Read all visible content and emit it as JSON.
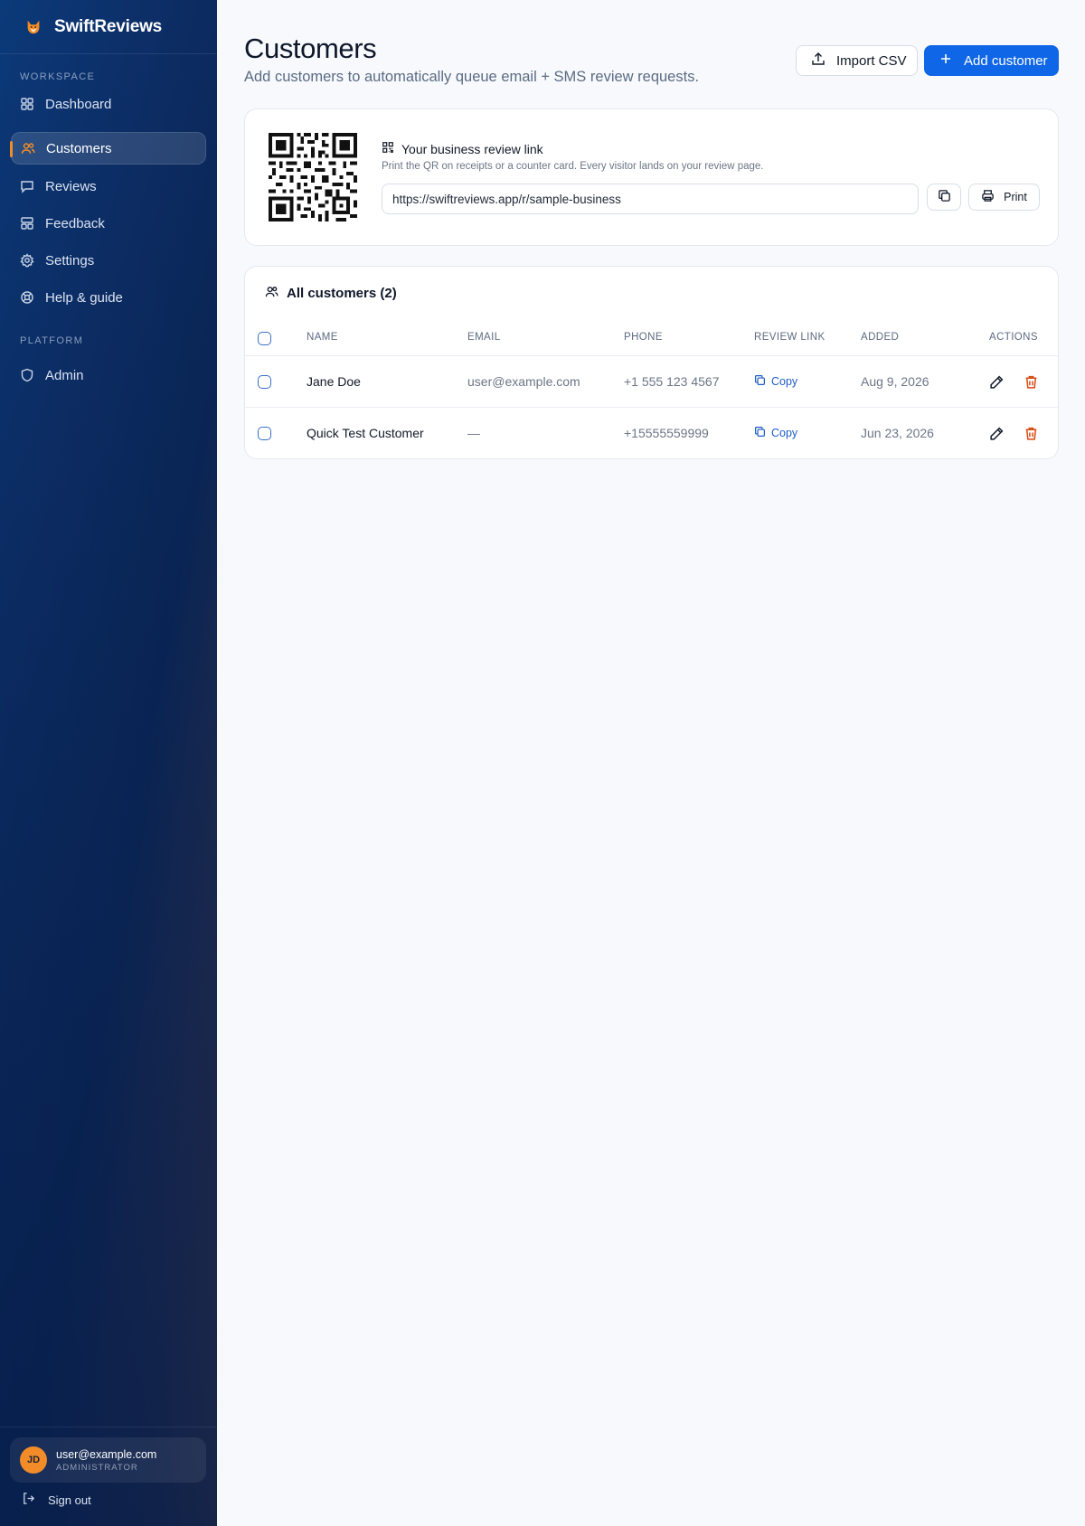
{
  "app": {
    "name": "SwiftReviews"
  },
  "sidebar": {
    "workspace_label": "WORKSPACE",
    "platform_label": "PLATFORM",
    "items": [
      {
        "label": "Dashboard",
        "icon": "grid-icon"
      },
      {
        "label": "Customers",
        "icon": "users-icon",
        "active": true
      },
      {
        "label": "Reviews",
        "icon": "message-icon"
      },
      {
        "label": "Feedback",
        "icon": "layout-icon"
      },
      {
        "label": "Settings",
        "icon": "gear-icon"
      },
      {
        "label": "Help & guide",
        "icon": "lifebuoy-icon"
      }
    ],
    "platform_items": [
      {
        "label": "Admin",
        "icon": "shield-icon"
      }
    ],
    "user": {
      "initials": "JD",
      "email": "user@example.com",
      "role": "ADMINISTRATOR"
    },
    "sign_out": "Sign out"
  },
  "header": {
    "title": "Customers",
    "subtitle": "Add customers to automatically queue email + SMS review requests.",
    "import_label": "Import CSV",
    "add_label": "Add customer"
  },
  "review_link": {
    "title": "Your business review link",
    "description": "Print the QR on receipts or a counter card. Every visitor lands on your review page.",
    "url": "https://swiftreviews.app/r/sample-business",
    "print_label": "Print"
  },
  "customers": {
    "title": "All customers (2)",
    "columns": [
      "NAME",
      "EMAIL",
      "PHONE",
      "REVIEW LINK",
      "ADDED",
      "ACTIONS"
    ],
    "rows": [
      {
        "name": "Jane Doe",
        "email": "user@example.com",
        "phone": "+1 555 123 4567",
        "link": "Copy",
        "added": "Aug 9, 2026"
      },
      {
        "name": "Quick Test Customer",
        "email": "—",
        "phone": "+15555559999",
        "link": "Copy",
        "added": "Jun 23, 2026"
      }
    ]
  },
  "colors": {
    "primary": "#0f66e6",
    "accent": "#f28c28",
    "danger": "#d9480f"
  }
}
